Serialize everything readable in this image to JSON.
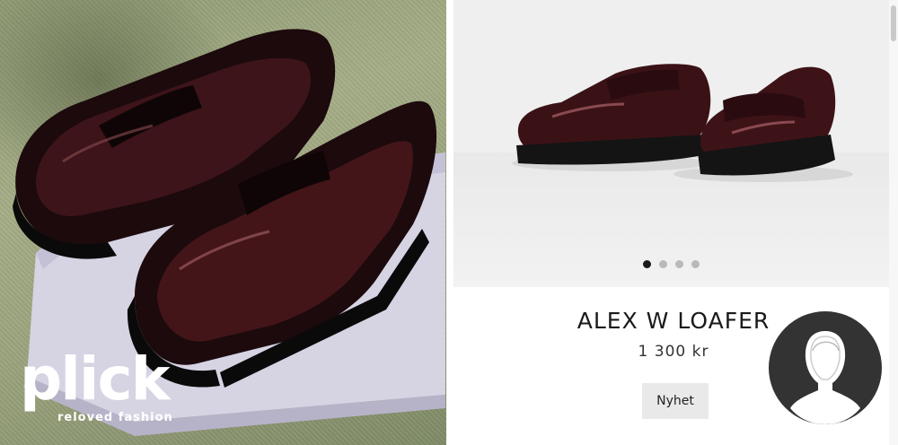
{
  "brand": {
    "name": "plick",
    "tagline": "reloved fashion"
  },
  "gallery": {
    "dot_count": 4,
    "active_index": 0
  },
  "product": {
    "name": "ALEX W LOAFER",
    "price": "1 300 kr",
    "badge": "Nyhet"
  },
  "colors": {
    "shoe_leather": "#3a1216",
    "sole": "#141414",
    "avatar_bg": "#333333",
    "badge_bg": "#e9e9e9"
  },
  "icons": {
    "avatar": "user-silhouette-icon"
  }
}
